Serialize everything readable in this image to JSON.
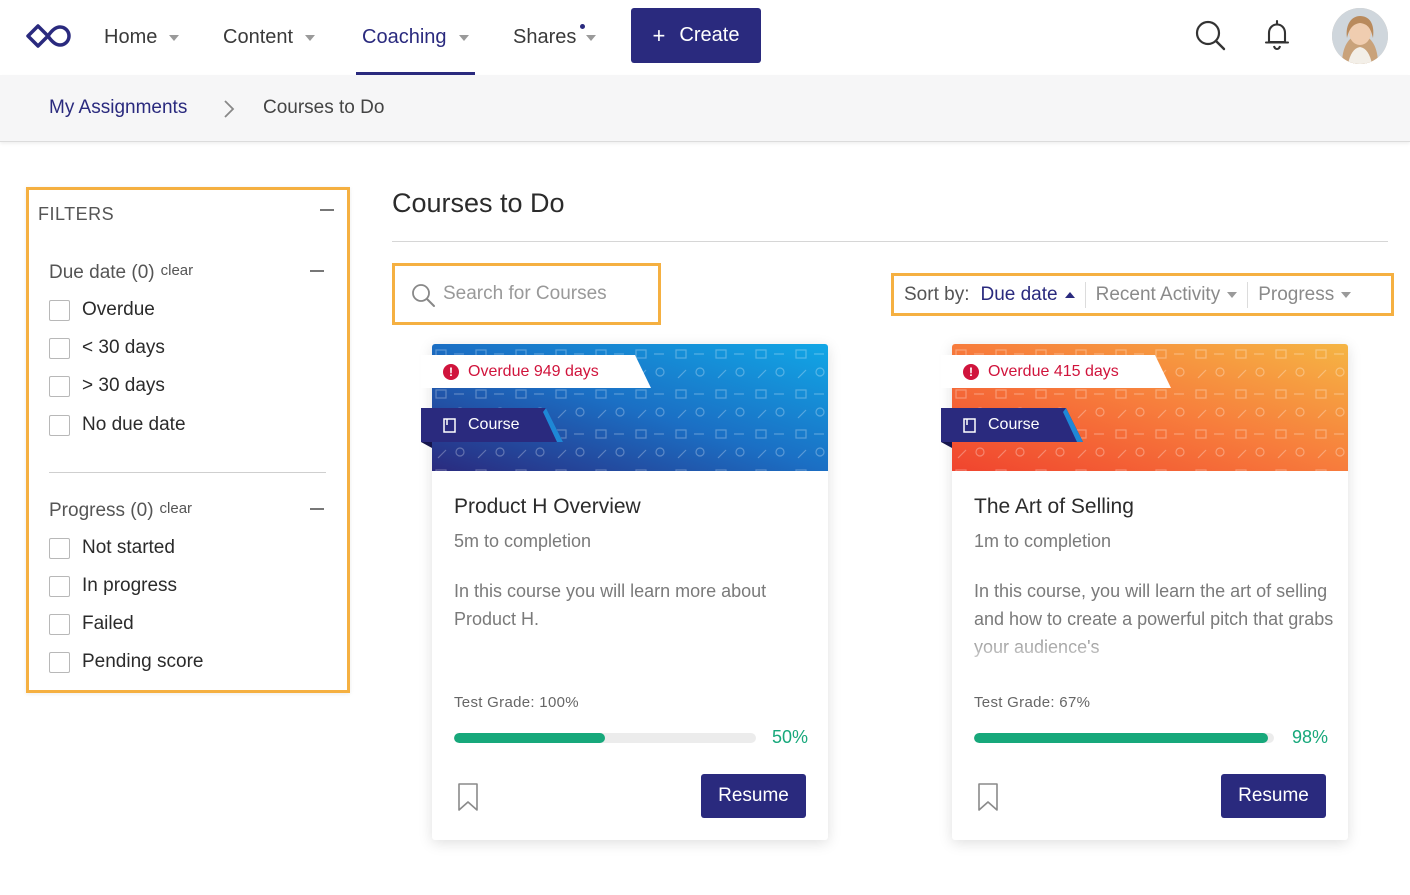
{
  "nav": {
    "items": [
      {
        "label": "Home"
      },
      {
        "label": "Content"
      },
      {
        "label": "Coaching"
      },
      {
        "label": "Shares"
      }
    ],
    "active": "Coaching",
    "create_label": "Create",
    "icons": [
      "logo-infinity-icon",
      "search-icon",
      "bell-icon",
      "avatar"
    ]
  },
  "breadcrumb": {
    "parent": "My Assignments",
    "current": "Courses to Do"
  },
  "filters": {
    "title": "FILTERS",
    "due_date": {
      "title": "Due date (0)",
      "clear": "clear",
      "options": [
        "Overdue",
        "< 30 days",
        "> 30 days",
        "No due date"
      ]
    },
    "progress": {
      "title": "Progress (0)",
      "clear": "clear",
      "options": [
        "Not started",
        "In progress",
        "Failed",
        "Pending score"
      ]
    }
  },
  "main": {
    "title": "Courses to Do",
    "search_placeholder": "Search for Courses",
    "sort": {
      "label": "Sort by:",
      "options": [
        "Due date",
        "Recent Activity",
        "Progress"
      ],
      "active": "Due date"
    }
  },
  "courses": [
    {
      "overdue": "Overdue 949 days",
      "type": "Course",
      "title": "Product H Overview",
      "duration": "5m to completion",
      "description": "In this course you will learn more about Product H.",
      "grade": "Test Grade: 100%",
      "progress": 50,
      "progress_label": "50%",
      "action": "Resume",
      "banner_colors": [
        "#2a2a7e",
        "#1b6fc4",
        "#11a7e6"
      ]
    },
    {
      "overdue": "Overdue 415 days",
      "type": "Course",
      "title": "The Art of Selling",
      "duration": "1m to completion",
      "description": "In this course, you will learn the art of selling and how to create a powerful pitch that grabs your audience's",
      "grade": "Test Grade: 67%",
      "progress": 98,
      "progress_label": "98%",
      "action": "Resume",
      "banner_colors": [
        "#f0442e",
        "#f77c3c",
        "#f5b544"
      ]
    }
  ],
  "colors": {
    "brand": "#2a2a7e",
    "highlight": "#f5b041",
    "overdue": "#d0143c",
    "progress": "#17a87b"
  }
}
